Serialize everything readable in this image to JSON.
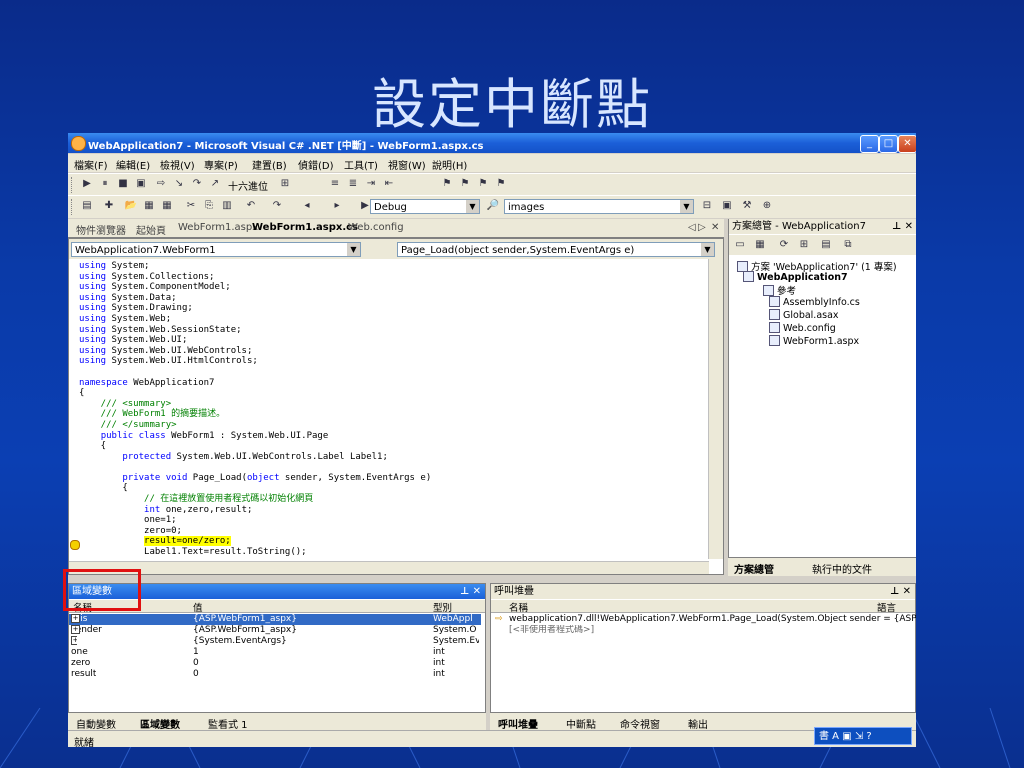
{
  "slide": {
    "title": "設定中斷點"
  },
  "window": {
    "title": "WebApplication7 - Microsoft Visual C# .NET [中斷] - WebForm1.aspx.cs"
  },
  "menu": [
    "檔案(F)",
    "編輯(E)",
    "檢視(V)",
    "專案(P)",
    "建置(B)",
    "偵錯(D)",
    "工具(T)",
    "視窗(W)",
    "說明(H)"
  ],
  "toolbar": {
    "hex_label": "十六進位",
    "config": "Debug",
    "find": "images"
  },
  "doc_tabs": [
    "物件瀏覽器",
    "起始頁",
    "WebForm1.aspx",
    "WebForm1.aspx.cs",
    "Web.config"
  ],
  "editor": {
    "class_combo": "WebApplication7.WebForm1",
    "member_combo": "Page_Load(object sender,System.EventArgs e)"
  },
  "code": [
    [
      {
        "t": "using",
        "c": "kw"
      },
      {
        "t": " System;"
      }
    ],
    [
      {
        "t": "using",
        "c": "kw"
      },
      {
        "t": " System.Collections;"
      }
    ],
    [
      {
        "t": "using",
        "c": "kw"
      },
      {
        "t": " System.ComponentModel;"
      }
    ],
    [
      {
        "t": "using",
        "c": "kw"
      },
      {
        "t": " System.Data;"
      }
    ],
    [
      {
        "t": "using",
        "c": "kw"
      },
      {
        "t": " System.Drawing;"
      }
    ],
    [
      {
        "t": "using",
        "c": "kw"
      },
      {
        "t": " System.Web;"
      }
    ],
    [
      {
        "t": "using",
        "c": "kw"
      },
      {
        "t": " System.Web.SessionState;"
      }
    ],
    [
      {
        "t": "using",
        "c": "kw"
      },
      {
        "t": " System.Web.UI;"
      }
    ],
    [
      {
        "t": "using",
        "c": "kw"
      },
      {
        "t": " System.Web.UI.WebControls;"
      }
    ],
    [
      {
        "t": "using",
        "c": "kw"
      },
      {
        "t": " System.Web.UI.HtmlControls;"
      }
    ],
    [
      {
        "t": ""
      }
    ],
    [
      {
        "t": "namespace",
        "c": "kw"
      },
      {
        "t": " WebApplication7"
      }
    ],
    [
      {
        "t": "{"
      }
    ],
    [
      {
        "t": "    /// <summary>",
        "c": "cm"
      }
    ],
    [
      {
        "t": "    /// WebForm1 的摘要描述。",
        "c": "cm"
      }
    ],
    [
      {
        "t": "    /// </summary>",
        "c": "cm"
      }
    ],
    [
      {
        "t": "    "
      },
      {
        "t": "public class",
        "c": "kw"
      },
      {
        "t": " WebForm1 : System.Web.UI.Page"
      }
    ],
    [
      {
        "t": "    {"
      }
    ],
    [
      {
        "t": "        "
      },
      {
        "t": "protected",
        "c": "kw"
      },
      {
        "t": " System.Web.UI.WebControls.Label Label1;"
      }
    ],
    [
      {
        "t": ""
      }
    ],
    [
      {
        "t": "        "
      },
      {
        "t": "private void",
        "c": "kw"
      },
      {
        "t": " Page_Load("
      },
      {
        "t": "object",
        "c": "kw"
      },
      {
        "t": " sender, System.EventArgs e)"
      }
    ],
    [
      {
        "t": "        {"
      }
    ],
    [
      {
        "t": "            // 在這裡放置使用者程式碼以初始化網頁",
        "c": "cm"
      }
    ],
    [
      {
        "t": "            "
      },
      {
        "t": "int",
        "c": "kw"
      },
      {
        "t": " one,zero,result;"
      }
    ],
    [
      {
        "t": "            one=1;"
      }
    ],
    [
      {
        "t": "            zero=0;"
      }
    ],
    [
      {
        "t": "            "
      },
      {
        "t": "result=one/zero;",
        "c": "hl"
      }
    ],
    [
      {
        "t": "            Label1.Text=result.ToString();"
      }
    ]
  ],
  "solution": {
    "title": "方案總管 - WebApplication7",
    "root": "方案 'WebApplication7' (1 專案)",
    "project": "WebApplication7",
    "items": [
      "參考",
      "AssemblyInfo.cs",
      "Global.asax",
      "Web.config",
      "WebForm1.aspx"
    ],
    "tabs": [
      "方案總管",
      "執行中的文件"
    ]
  },
  "locals": {
    "title": "區域變數",
    "headers": [
      "名稱",
      "值",
      "型別"
    ],
    "rows": [
      {
        "name": "this",
        "value": "{ASP.WebForm1_aspx}",
        "type": "WebAppl",
        "exp": true,
        "sel": true
      },
      {
        "name": "sender",
        "value": "{ASP.WebForm1_aspx}",
        "type": "System.O",
        "exp": true
      },
      {
        "name": "e",
        "value": "{System.EventArgs}",
        "type": "System.Ev",
        "exp": true
      },
      {
        "name": "one",
        "value": "1",
        "type": "int"
      },
      {
        "name": "zero",
        "value": "0",
        "type": "int"
      },
      {
        "name": "result",
        "value": "0",
        "type": "int"
      }
    ],
    "tabs": [
      "自動變數",
      "區域變數",
      "監看式 1"
    ]
  },
  "callstack": {
    "title": "呼叫堆疊",
    "headers": [
      "名稱",
      "語言"
    ],
    "line1": "webapplication7.dll!WebApplication7.WebForm1.Page_Load(System.Object sender = {ASP.We C#",
    "line2": "[<非使用者程式碼>]",
    "tabs": [
      "呼叫堆疊",
      "中斷點",
      "命令視窗",
      "輸出"
    ]
  },
  "status": {
    "text": "就緒"
  }
}
